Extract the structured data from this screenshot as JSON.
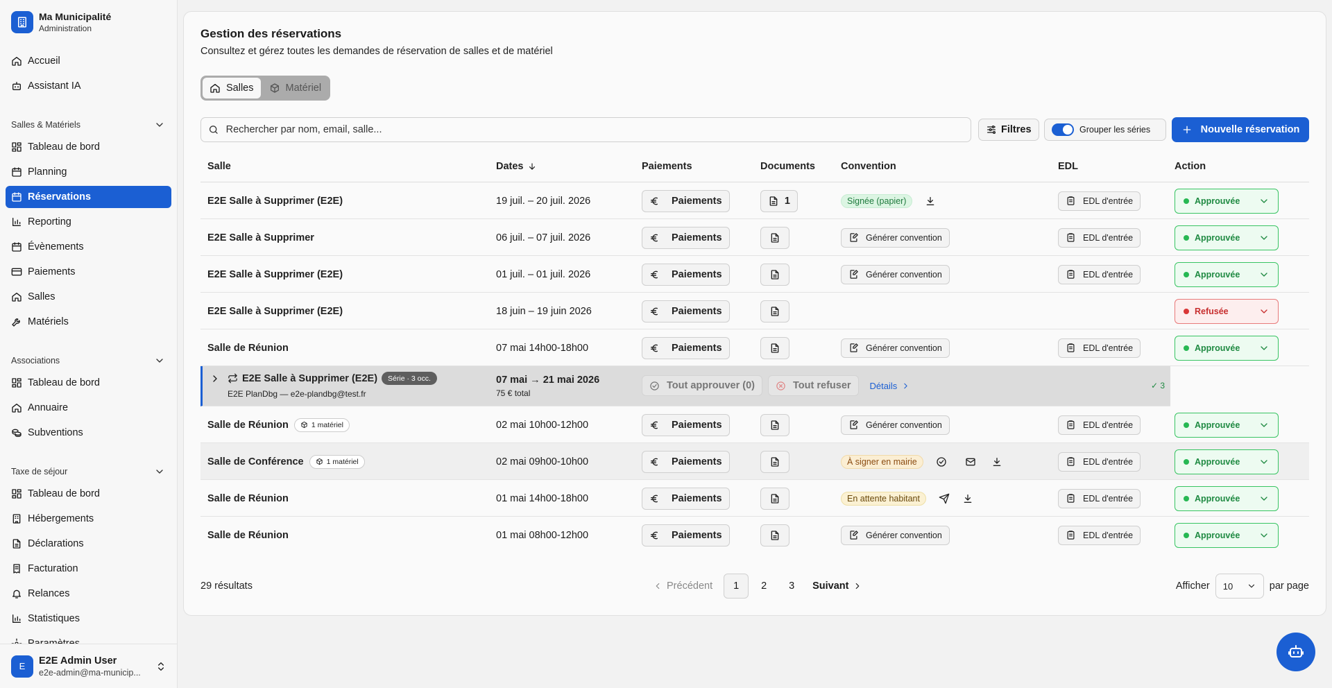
{
  "brand": {
    "title": "Ma Municipalité",
    "subtitle": "Administration"
  },
  "nav": {
    "top": [
      {
        "label": "Accueil",
        "icon": "home-icon"
      },
      {
        "label": "Assistant IA",
        "icon": "bot-icon"
      }
    ],
    "sections": [
      {
        "title": "Salles & Matériels",
        "items": [
          "Tableau de bord",
          "Planning",
          "Réservations",
          "Reporting",
          "Évènements",
          "Paiements",
          "Salles",
          "Matériels"
        ]
      },
      {
        "title": "Associations",
        "items": [
          "Tableau de bord",
          "Annuaire",
          "Subventions"
        ]
      },
      {
        "title": "Taxe de séjour",
        "items": [
          "Tableau de bord",
          "Hébergements",
          "Déclarations",
          "Facturation",
          "Relances",
          "Statistiques",
          "Paramètres"
        ]
      }
    ],
    "active": "Réservations"
  },
  "user": {
    "initial": "E",
    "name": "E2E Admin User",
    "email": "e2e-admin@ma-municip..."
  },
  "page": {
    "title": "Gestion des réservations",
    "description": "Consultez et gérez toutes les demandes de réservation de salles et de matériel",
    "tabs": [
      "Salles",
      "Matériel"
    ],
    "search_placeholder": "Rechercher par nom, email, salle...",
    "filters_label": "Filtres",
    "group_label": "Grouper les séries",
    "new_label": "Nouvelle réservation"
  },
  "table": {
    "columns": [
      "Salle",
      "Dates",
      "Paiements",
      "Documents",
      "Convention",
      "EDL",
      "Action"
    ],
    "payments_label": "Paiements",
    "generate_label": "Générer convention",
    "edl_label": "EDL d'entrée",
    "rows": [
      {
        "salle": "E2E Salle à Supprimer (E2E)",
        "dates": "19 juil. – 20 juil. 2026",
        "doc_count": "1",
        "convention": "Signée (papier)",
        "status": "Approuvée"
      },
      {
        "salle": "E2E Salle à Supprimer",
        "dates": "06 juil. – 07 juil. 2026",
        "status": "Approuvée"
      },
      {
        "salle": "E2E Salle à Supprimer (E2E)",
        "dates": "01 juil. – 01 juil. 2026",
        "status": "Approuvée"
      },
      {
        "salle": "E2E Salle à Supprimer (E2E)",
        "dates": "18 juin – 19 juin 2026",
        "status": "Refusée"
      },
      {
        "salle": "Salle de Réunion",
        "dates": "07 mai 14h00-18h00",
        "status": "Approuvée"
      },
      {
        "salle": "Salle de Réunion",
        "badge": "1 matériel",
        "dates": "02 mai 10h00-12h00",
        "status": "Approuvée"
      },
      {
        "salle": "Salle de Conférence",
        "badge": "1 matériel",
        "dates": "02 mai 09h00-10h00",
        "convention": "À signer en mairie",
        "status": "Approuvée"
      },
      {
        "salle": "Salle de Réunion",
        "dates": "01 mai 14h00-18h00",
        "convention": "En attente habitant",
        "status": "Approuvée"
      },
      {
        "salle": "Salle de Réunion",
        "dates": "01 mai 08h00-12h00",
        "status": "Approuvée"
      }
    ],
    "series": {
      "salle": "E2E Salle à Supprimer (E2E)",
      "badge": "Série · 3 occ.",
      "owner": "E2E PlanDbg — e2e-plandbg@test.fr",
      "dates": "07 mai → 21 mai 2026",
      "total": "75 € total",
      "approve_all": "Tout approuver (0)",
      "refuse_all": "Tout refuser",
      "details": "Détails",
      "approved_count": "✓ 3"
    }
  },
  "pagination": {
    "results": "29 résultats",
    "prev": "Précédent",
    "pages": [
      "1",
      "2",
      "3"
    ],
    "current": "1",
    "next": "Suivant",
    "show_label": "Afficher",
    "per_page_value": "10",
    "per_page_label": "par page"
  }
}
